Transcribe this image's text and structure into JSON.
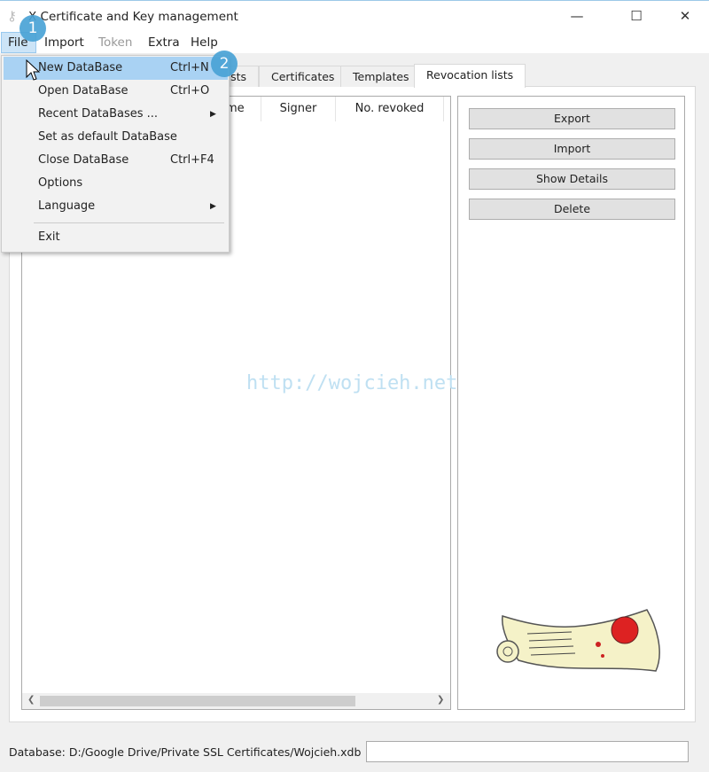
{
  "window": {
    "title": "X Certificate and Key management",
    "minimize": "—",
    "maximize": "☐",
    "close": "✕"
  },
  "menubar": [
    {
      "label": "File"
    },
    {
      "label": "Import"
    },
    {
      "label": "Token"
    },
    {
      "label": "Extra"
    },
    {
      "label": "Help"
    }
  ],
  "tabs": [
    {
      "label": "sts"
    },
    {
      "label": "Certificates"
    },
    {
      "label": "Templates"
    },
    {
      "label": "Revocation lists",
      "active": true
    }
  ],
  "table": {
    "columns": [
      "me",
      "Signer",
      "No. revoked"
    ]
  },
  "buttons": {
    "export": "Export",
    "import": "Import",
    "show_details": "Show Details",
    "delete": "Delete"
  },
  "file_menu": [
    {
      "label": "New DataBase",
      "shortcut": "Ctrl+N",
      "highlighted": true
    },
    {
      "label": "Open DataBase",
      "shortcut": "Ctrl+O"
    },
    {
      "label": "Recent DataBases ...",
      "submenu": true
    },
    {
      "label": "Set as default DataBase"
    },
    {
      "label": "Close DataBase",
      "shortcut": "Ctrl+F4"
    },
    {
      "label": "Options"
    },
    {
      "label": "Language",
      "submenu": true
    },
    {
      "label": "Exit"
    }
  ],
  "badges": [
    "1",
    "2"
  ],
  "watermark": "http://wojcieh.net",
  "status": {
    "database": "Database: D:/Google Drive/Private SSL Certificates/Wojcieh.xdb"
  },
  "colors": {
    "accent": "#4aa3d6",
    "highlight": "#a9d2f3"
  }
}
